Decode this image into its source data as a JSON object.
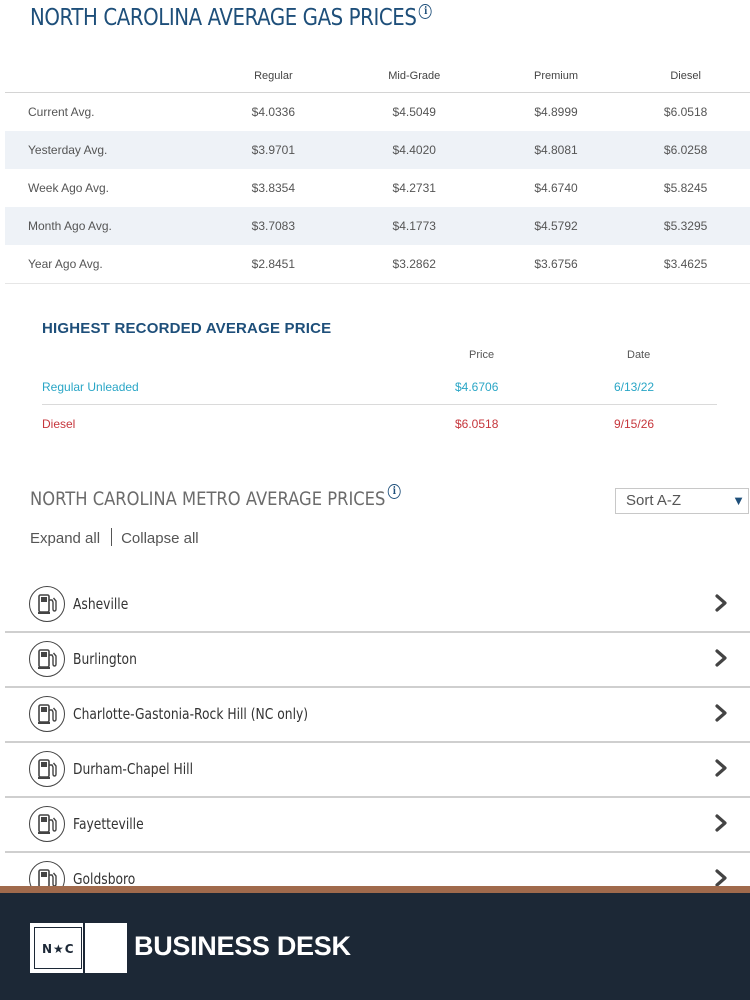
{
  "header": {
    "title": "NORTH CAROLINA AVERAGE GAS PRICES",
    "info_icon": "info-icon"
  },
  "avg_table": {
    "columns": [
      "Regular",
      "Mid-Grade",
      "Premium",
      "Diesel"
    ],
    "rows": [
      {
        "label": "Current Avg.",
        "values": [
          "$4.0336",
          "$4.5049",
          "$4.8999",
          "$6.0518"
        ]
      },
      {
        "label": "Yesterday Avg.",
        "values": [
          "$3.9701",
          "$4.4020",
          "$4.8081",
          "$6.0258"
        ]
      },
      {
        "label": "Week Ago Avg.",
        "values": [
          "$3.8354",
          "$4.2731",
          "$4.6740",
          "$5.8245"
        ]
      },
      {
        "label": "Month Ago Avg.",
        "values": [
          "$3.7083",
          "$4.1773",
          "$4.5792",
          "$5.3295"
        ]
      },
      {
        "label": "Year Ago Avg.",
        "values": [
          "$2.8451",
          "$3.2862",
          "$3.6756",
          "$3.4625"
        ]
      }
    ]
  },
  "highest": {
    "title": "HIGHEST RECORDED AVERAGE PRICE",
    "price_header": "Price",
    "date_header": "Date",
    "rows": [
      {
        "label": "Regular Unleaded",
        "price": "$4.6706",
        "date": "6/13/22",
        "color": "#2aa6c6"
      },
      {
        "label": "Diesel",
        "price": "$6.0518",
        "date": "9/15/26",
        "color": "#c6363c"
      }
    ]
  },
  "metro": {
    "title": "NORTH CAROLINA METRO AVERAGE PRICES",
    "sort": {
      "selected": "Sort A-Z"
    },
    "expand_all": "Expand all",
    "collapse_all": "Collapse all",
    "items": [
      {
        "name": "Asheville"
      },
      {
        "name": "Burlington"
      },
      {
        "name": "Charlotte-Gastonia-Rock Hill (NC only)"
      },
      {
        "name": "Durham-Chapel Hill"
      },
      {
        "name": "Fayetteville"
      },
      {
        "name": "Goldsboro"
      }
    ],
    "item_icon": "gas-pump-icon",
    "item_action_icon": "chevron-right-icon"
  },
  "footer": {
    "logo_text": "N★C",
    "brand": "BUSINESS DESK"
  },
  "colors": {
    "primary": "#1e4f7a",
    "regular": "#2aa6c6",
    "diesel": "#c6363c",
    "footer_bg": "#1c2836",
    "footer_accent": "#a06a4c"
  }
}
